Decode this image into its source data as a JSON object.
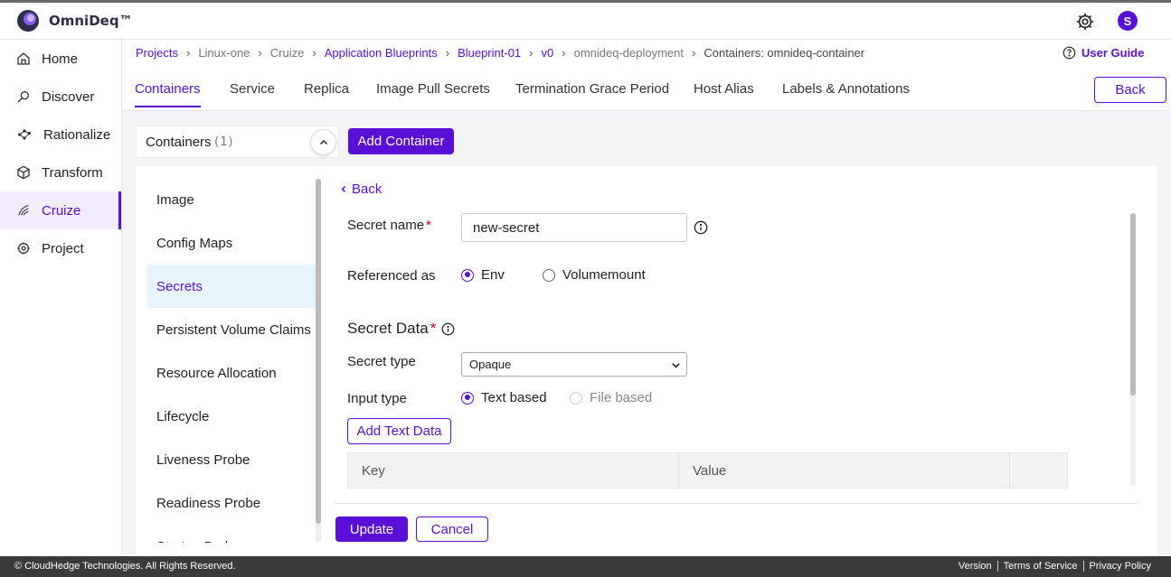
{
  "app": {
    "name": "OmniDeq™",
    "user_initial": "S"
  },
  "sidebar": {
    "items": [
      {
        "label": "Home",
        "icon": "home-icon"
      },
      {
        "label": "Discover",
        "icon": "search-icon"
      },
      {
        "label": "Rationalize",
        "icon": "network-icon"
      },
      {
        "label": "Transform",
        "icon": "cube-icon"
      },
      {
        "label": "Cruize",
        "icon": "cruize-icon",
        "active": true
      },
      {
        "label": "Project",
        "icon": "gear-icon"
      }
    ]
  },
  "breadcrumb": {
    "items": [
      "Projects",
      "Linux-one",
      "Cruize",
      "Application Blueprints",
      "Blueprint-01",
      "v0",
      "omnideq-deployment",
      "Containers: omnideq-container"
    ],
    "user_guide": "User Guide"
  },
  "tabs": {
    "items": [
      "Containers",
      "Service",
      "Replica",
      "Image Pull Secrets",
      "Termination Grace Period",
      "Host Alias",
      "Labels & Annotations"
    ],
    "active": "Containers",
    "back_label": "Back"
  },
  "containers": {
    "label": "Containers",
    "count": "(1)",
    "add_label": "Add Container"
  },
  "sub_nav": {
    "items": [
      "Image",
      "Config Maps",
      "Secrets",
      "Persistent Volume Claims",
      "Resource Allocation",
      "Lifecycle",
      "Liveness Probe",
      "Readiness Probe",
      "Startup Probe"
    ],
    "active": "Secrets"
  },
  "form": {
    "back_label": "Back",
    "secret_name_label": "Secret name",
    "secret_name_value": "new-secret",
    "required_mark": "*",
    "referenced_as_label": "Referenced as",
    "referenced_options": [
      "Env",
      "Volumemount"
    ],
    "referenced_selected": "Env",
    "secret_data_title": "Secret Data",
    "secret_type_label": "Secret type",
    "secret_type_value": "Opaque",
    "input_type_label": "Input type",
    "input_options": [
      "Text based",
      "File based"
    ],
    "input_selected": "Text based",
    "add_text_label": "Add Text Data",
    "table_headers": [
      "Key",
      "Value",
      ""
    ],
    "update_label": "Update",
    "cancel_label": "Cancel"
  },
  "footer": {
    "copyright": "© CloudHedge Technologies. All Rights Reserved.",
    "links": [
      "Version",
      "Terms of Service",
      "Privacy Policy"
    ]
  },
  "colors": {
    "accent": "#5a0fd6",
    "footer": "#3a3a3a",
    "active_sub_bg": "#e6f4fb"
  }
}
